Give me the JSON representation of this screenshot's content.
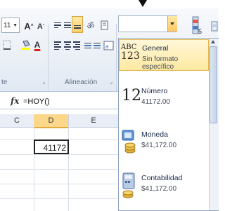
{
  "ribbon": {
    "font_size": "11",
    "grow_font_glyph": "A",
    "shrink_font_glyph": "A",
    "font_color_glyph": "A",
    "group_font_label": "te",
    "group_alignment_label": "Alineación"
  },
  "formula_bar": {
    "fx_label": "fx",
    "formula": "=HOY()"
  },
  "grid": {
    "columns": [
      "C",
      "D",
      "E"
    ],
    "active_column": "D",
    "active_cell_value": "41172"
  },
  "number_format": {
    "current_value": "",
    "items": [
      {
        "name": "General",
        "sample": "Sin formato específico",
        "icon_text_top": "ABC",
        "icon_text_bottom": "123",
        "icon": "general-format-icon"
      },
      {
        "name": "Número",
        "sample": "41172.00",
        "icon_text_top": "12",
        "icon_text_bottom": "",
        "icon": "number-format-icon"
      },
      {
        "name": "Moneda",
        "sample": "$41,172.00",
        "icon_text_top": "",
        "icon_text_bottom": "",
        "icon": "currency-format-icon"
      },
      {
        "name": "Contabilidad",
        "sample": "$41,172.00",
        "icon_text_top": "",
        "icon_text_bottom": "",
        "icon": "accounting-format-icon"
      }
    ]
  },
  "colors": {
    "selected_item_bg": "#ffe9a1",
    "active_header": "#fbd78a",
    "font_color_underline": "#d9231d",
    "fill_color_underline": "#ffff00"
  }
}
